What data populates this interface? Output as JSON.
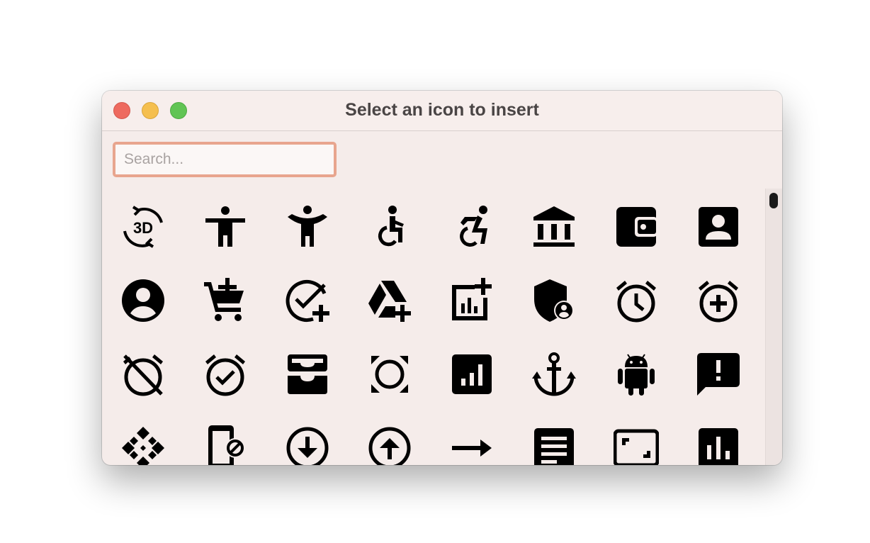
{
  "window": {
    "title": "Select an icon to insert"
  },
  "search": {
    "placeholder": "Search...",
    "value": ""
  },
  "icons": [
    "3d-rotation-icon",
    "accessibility-icon",
    "accessibility-new-icon",
    "accessible-icon",
    "accessible-forward-icon",
    "account-balance-icon",
    "account-balance-wallet-icon",
    "account-box-icon",
    "account-circle-icon",
    "add-shopping-cart-icon",
    "add-task-icon",
    "add-to-drive-icon",
    "addchart-icon",
    "admin-panel-settings-icon",
    "alarm-icon",
    "alarm-add-icon",
    "alarm-off-icon",
    "alarm-on-icon",
    "all-inbox-icon",
    "all-out-icon",
    "analytics-icon",
    "anchor-icon",
    "android-icon",
    "announcement-icon",
    "api-icon",
    "app-blocking-icon",
    "arrow-circle-down-icon",
    "arrow-circle-up-icon",
    "arrow-right-alt-icon",
    "article-icon",
    "aspect-ratio-icon",
    "assessment-icon"
  ]
}
